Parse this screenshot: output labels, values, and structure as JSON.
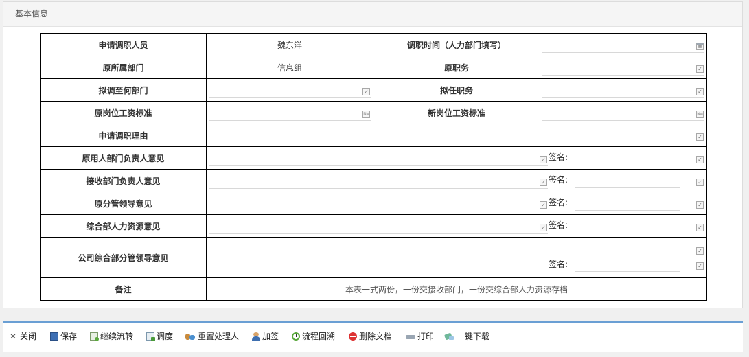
{
  "panel": {
    "title": "基本信息"
  },
  "form": {
    "applicant_label": "申请调职人员",
    "applicant_value": "魏东洋",
    "transfer_time_label": "调职时间（人力部门填写）",
    "orig_dept_label": "原所属部门",
    "orig_dept_value": "信息组",
    "orig_position_label": "原职务",
    "target_dept_label": "拟调至何部门",
    "target_position_label": "拟任职务",
    "orig_salary_label": "原岗位工资标准",
    "new_salary_label": "新岗位工资标准",
    "reason_label": "申请调职理由",
    "orig_head_label": "原用人部门负责人意见",
    "recv_head_label": "接收部门负责人意见",
    "orig_leader_label": "原分管领导意见",
    "hr_label": "综合部人力资源意见",
    "company_leader_label": "公司综合部分管领导意见",
    "sign_label": "签名:",
    "remark_label": "备注",
    "remark_value": "本表一式两份，一份交接收部门，一份交综合部人力资源存档"
  },
  "toolbar": {
    "close": "关闭",
    "save": "保存",
    "continue_flow": "继续流转",
    "dispatch": "调度",
    "reset_handler": "重置处理人",
    "countersign": "加签",
    "flow_trace": "流程回溯",
    "delete_doc": "删除文档",
    "print": "打印",
    "one_click_download": "一键下载"
  },
  "icons": {
    "calendar": "calendar-icon",
    "edit": "edit-checkbox-icon",
    "number": "number-icon"
  },
  "colors": {
    "accent": "#6a9fd4",
    "border": "#000000",
    "background": "#f0f0f0"
  }
}
